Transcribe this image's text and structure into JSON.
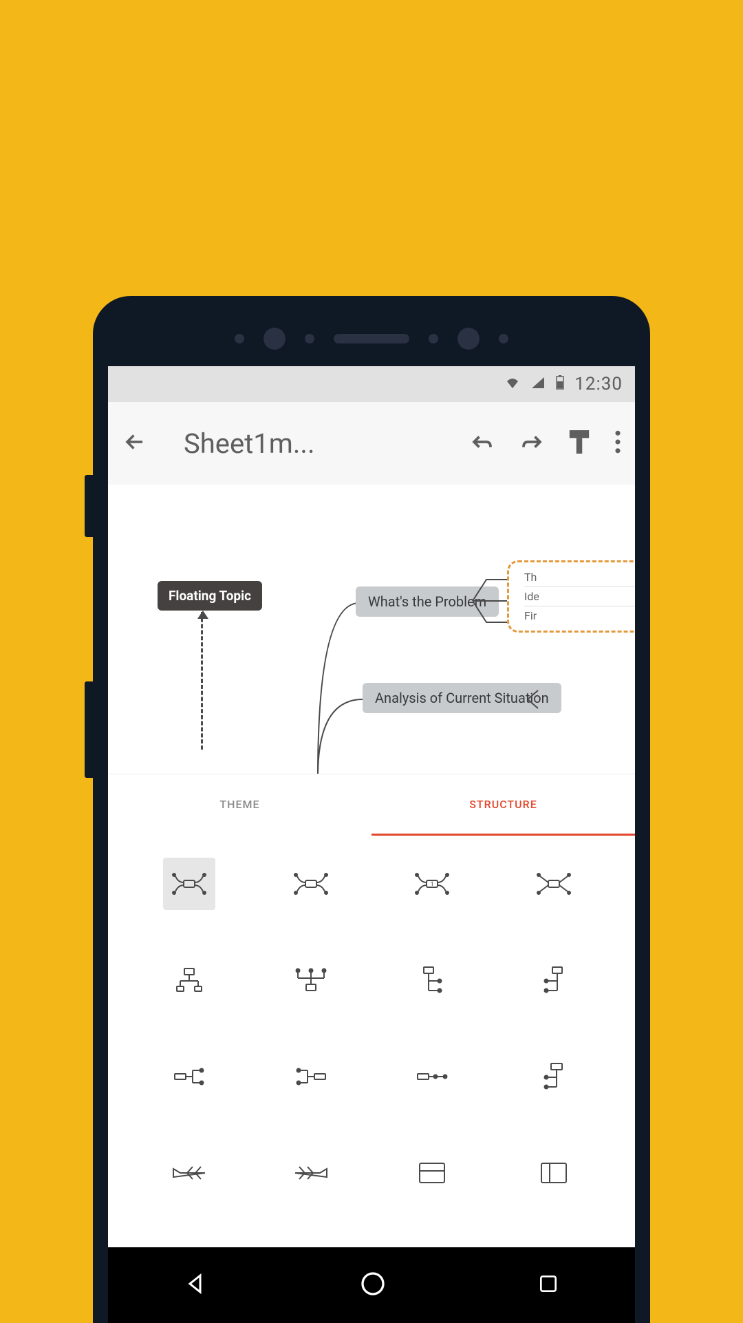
{
  "statusbar": {
    "time": "12:30"
  },
  "appbar": {
    "title": "Sheet1m..."
  },
  "canvas": {
    "floating_topic": "Floating Topic",
    "node1": "What's the Problem",
    "node2": "Analysis of Current Situation",
    "sub1": "Th",
    "sub2": "Ide",
    "sub3": "Fir"
  },
  "tabs": {
    "theme": "THEME",
    "structure": "STRUCTURE"
  }
}
